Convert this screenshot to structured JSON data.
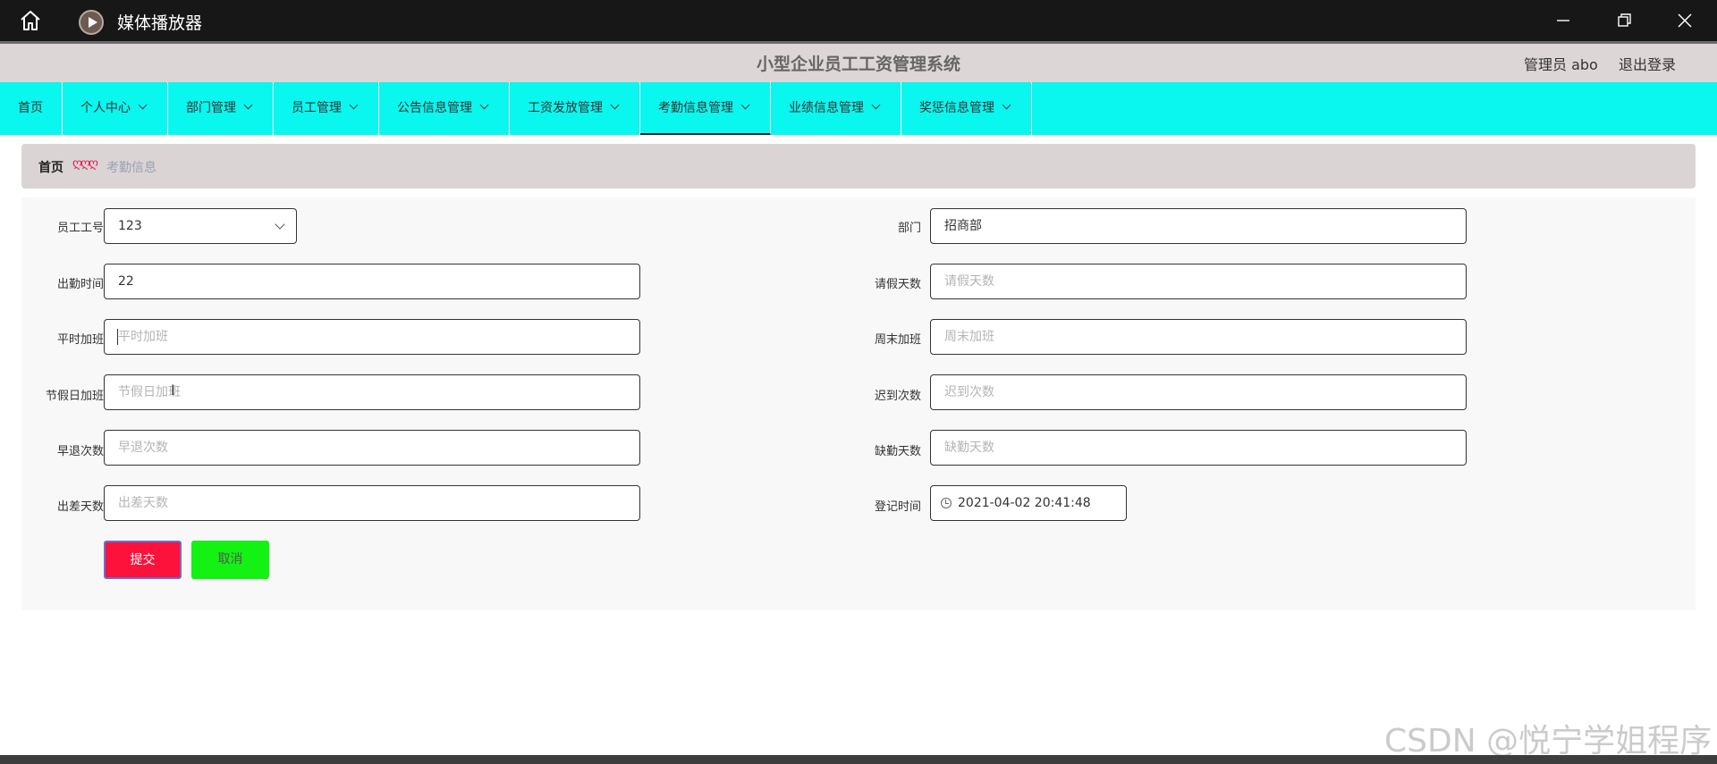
{
  "window": {
    "app_title": "媒体播放器"
  },
  "header": {
    "system_title": "小型企业员工工资管理系统",
    "admin_label": "管理员 abo",
    "logout_label": "退出登录"
  },
  "nav": {
    "items": [
      {
        "label": "首页"
      },
      {
        "label": "个人中心"
      },
      {
        "label": "部门管理"
      },
      {
        "label": "员工管理"
      },
      {
        "label": "公告信息管理"
      },
      {
        "label": "工资发放管理"
      },
      {
        "label": "考勤信息管理"
      },
      {
        "label": "业绩信息管理"
      },
      {
        "label": "奖惩信息管理"
      }
    ],
    "active_index": 6
  },
  "breadcrumb": {
    "home": "首页",
    "separator": "ღღღ",
    "current": "考勤信息"
  },
  "form": {
    "employee_no": {
      "label": "员工工号",
      "value": "123"
    },
    "department": {
      "label": "部门",
      "value": "招商部"
    },
    "attendance_time": {
      "label": "出勤时间",
      "value": "22"
    },
    "leave_days": {
      "label": "请假天数",
      "placeholder": "请假天数"
    },
    "weekday_overtime": {
      "label": "平时加班",
      "placeholder": "平时加班"
    },
    "weekend_overtime": {
      "label": "周末加班",
      "placeholder": "周末加班"
    },
    "holiday_overtime": {
      "label": "节假日加班",
      "placeholder": "节假日加班"
    },
    "late_count": {
      "label": "迟到次数",
      "placeholder": "迟到次数"
    },
    "early_leave_count": {
      "label": "早退次数",
      "placeholder": "早退次数"
    },
    "absent_days": {
      "label": "缺勤天数",
      "placeholder": "缺勤天数"
    },
    "trip_days": {
      "label": "出差天数",
      "placeholder": "出差天数"
    },
    "register_time": {
      "label": "登记时间",
      "value": "2021-04-02 20:41:48"
    },
    "submit_label": "提交",
    "cancel_label": "取消"
  },
  "colors": {
    "nav_bg": "#09f7ef",
    "submit_bg": "#fd123c",
    "cancel_bg": "#13f213"
  },
  "watermark": "CSDN @悦宁学姐程序"
}
